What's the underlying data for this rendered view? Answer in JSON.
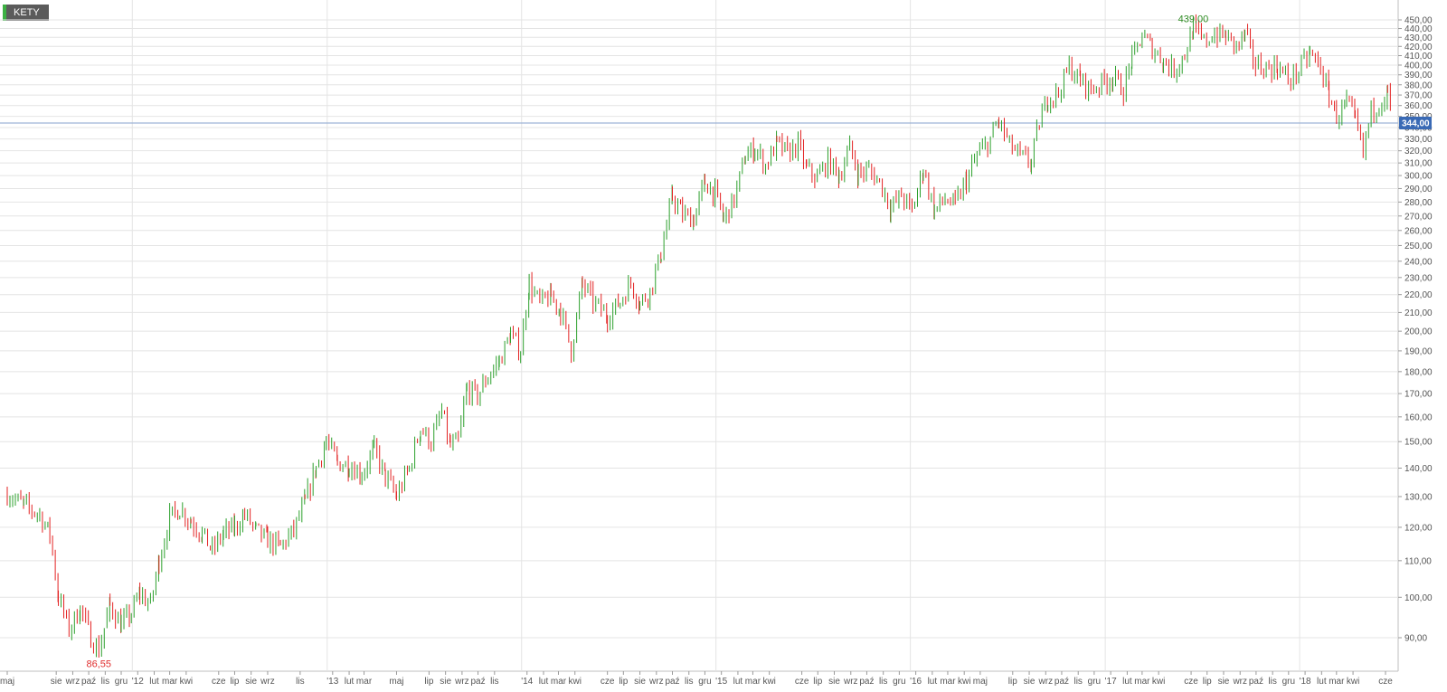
{
  "symbol": "KETY",
  "colors": {
    "up": "#2ca02c",
    "down": "#e32222",
    "grid": "#e4e4e4",
    "priceline": "#9db3d6",
    "pricetag": "#3a6ab5"
  },
  "chart_data": {
    "type": "candlestick",
    "title": "KETY",
    "y_scale": "log",
    "ylim": [
      84,
      460
    ],
    "y_ticks": [
      "90,00",
      "100,00",
      "110,00",
      "120,00",
      "130,00",
      "140,00",
      "150,00",
      "160,00",
      "170,00",
      "180,00",
      "190,00",
      "200,00",
      "210,00",
      "220,00",
      "230,00",
      "240,00",
      "250,00",
      "260,00",
      "270,00",
      "280,00",
      "290,00",
      "300,00",
      "310,00",
      "320,00",
      "330,00",
      "340,00",
      "350,00",
      "360,00",
      "370,00",
      "380,00",
      "390,00",
      "400,00",
      "410,00",
      "420,00",
      "430,00",
      "440,00",
      "450,00"
    ],
    "x_range": [
      "2011-05",
      "2018-06"
    ],
    "x_labels": [
      {
        "label": "maj",
        "date": "2011-05-01"
      },
      {
        "label": "sie",
        "date": "2011-08-01"
      },
      {
        "label": "wrz",
        "date": "2011-09-01"
      },
      {
        "label": "paź",
        "date": "2011-10-01"
      },
      {
        "label": "lis",
        "date": "2011-11-01"
      },
      {
        "label": "gru",
        "date": "2011-12-01"
      },
      {
        "label": "'12",
        "date": "2012-01-01"
      },
      {
        "label": "lut",
        "date": "2012-02-01"
      },
      {
        "label": "mar",
        "date": "2012-03-01"
      },
      {
        "label": "kwi",
        "date": "2012-04-01"
      },
      {
        "label": "cze",
        "date": "2012-06-01"
      },
      {
        "label": "lip",
        "date": "2012-07-01"
      },
      {
        "label": "sie",
        "date": "2012-08-01"
      },
      {
        "label": "wrz",
        "date": "2012-09-01"
      },
      {
        "label": "lis",
        "date": "2012-11-01"
      },
      {
        "label": "'13",
        "date": "2013-01-01"
      },
      {
        "label": "lut",
        "date": "2013-02-01"
      },
      {
        "label": "mar",
        "date": "2013-03-01"
      },
      {
        "label": "maj",
        "date": "2013-05-01"
      },
      {
        "label": "lip",
        "date": "2013-07-01"
      },
      {
        "label": "sie",
        "date": "2013-08-01"
      },
      {
        "label": "wrz",
        "date": "2013-09-01"
      },
      {
        "label": "paź",
        "date": "2013-10-01"
      },
      {
        "label": "lis",
        "date": "2013-11-01"
      },
      {
        "label": "'14",
        "date": "2014-01-01"
      },
      {
        "label": "lut",
        "date": "2014-02-01"
      },
      {
        "label": "mar",
        "date": "2014-03-01"
      },
      {
        "label": "kwi",
        "date": "2014-04-01"
      },
      {
        "label": "cze",
        "date": "2014-06-01"
      },
      {
        "label": "lip",
        "date": "2014-07-01"
      },
      {
        "label": "sie",
        "date": "2014-08-01"
      },
      {
        "label": "wrz",
        "date": "2014-09-01"
      },
      {
        "label": "paź",
        "date": "2014-10-01"
      },
      {
        "label": "lis",
        "date": "2014-11-01"
      },
      {
        "label": "gru",
        "date": "2014-12-01"
      },
      {
        "label": "'15",
        "date": "2015-01-01"
      },
      {
        "label": "lut",
        "date": "2015-02-01"
      },
      {
        "label": "mar",
        "date": "2015-03-01"
      },
      {
        "label": "kwi",
        "date": "2015-04-01"
      },
      {
        "label": "cze",
        "date": "2015-06-01"
      },
      {
        "label": "lip",
        "date": "2015-07-01"
      },
      {
        "label": "sie",
        "date": "2015-08-01"
      },
      {
        "label": "wrz",
        "date": "2015-09-01"
      },
      {
        "label": "paź",
        "date": "2015-10-01"
      },
      {
        "label": "lis",
        "date": "2015-11-01"
      },
      {
        "label": "gru",
        "date": "2015-12-01"
      },
      {
        "label": "'16",
        "date": "2016-01-01"
      },
      {
        "label": "lut",
        "date": "2016-02-01"
      },
      {
        "label": "mar",
        "date": "2016-03-01"
      },
      {
        "label": "kwi",
        "date": "2016-04-01"
      },
      {
        "label": "maj",
        "date": "2016-05-01"
      },
      {
        "label": "lip",
        "date": "2016-07-01"
      },
      {
        "label": "sie",
        "date": "2016-08-01"
      },
      {
        "label": "wrz",
        "date": "2016-09-01"
      },
      {
        "label": "paź",
        "date": "2016-10-01"
      },
      {
        "label": "lis",
        "date": "2016-11-01"
      },
      {
        "label": "gru",
        "date": "2016-12-01"
      },
      {
        "label": "'17",
        "date": "2017-01-01"
      },
      {
        "label": "lut",
        "date": "2017-02-01"
      },
      {
        "label": "mar",
        "date": "2017-03-01"
      },
      {
        "label": "kwi",
        "date": "2017-04-01"
      },
      {
        "label": "cze",
        "date": "2017-06-01"
      },
      {
        "label": "lip",
        "date": "2017-07-01"
      },
      {
        "label": "sie",
        "date": "2017-08-01"
      },
      {
        "label": "wrz",
        "date": "2017-09-01"
      },
      {
        "label": "paź",
        "date": "2017-10-01"
      },
      {
        "label": "lis",
        "date": "2017-11-01"
      },
      {
        "label": "gru",
        "date": "2017-12-01"
      },
      {
        "label": "'18",
        "date": "2018-01-01"
      },
      {
        "label": "lut",
        "date": "2018-02-01"
      },
      {
        "label": "mar",
        "date": "2018-03-01"
      },
      {
        "label": "kwi",
        "date": "2018-04-01"
      },
      {
        "label": "cze",
        "date": "2018-06-01"
      }
    ],
    "series": [
      {
        "name": "KETY",
        "points": [
          [
            "2011-05-01",
            131
          ],
          [
            "2011-06-01",
            127
          ],
          [
            "2011-07-01",
            124
          ],
          [
            "2011-07-20",
            118
          ],
          [
            "2011-08-05",
            100
          ],
          [
            "2011-08-25",
            92
          ],
          [
            "2011-09-15",
            97
          ],
          [
            "2011-10-05",
            90
          ],
          [
            "2011-10-20",
            87
          ],
          [
            "2011-11-10",
            98
          ],
          [
            "2011-12-01",
            93
          ],
          [
            "2011-12-20",
            96
          ],
          [
            "2012-01-05",
            101
          ],
          [
            "2012-01-25",
            98
          ],
          [
            "2012-02-10",
            110
          ],
          [
            "2012-03-01",
            123
          ],
          [
            "2012-03-20",
            126
          ],
          [
            "2012-04-10",
            122
          ],
          [
            "2012-05-01",
            118
          ],
          [
            "2012-05-20",
            113
          ],
          [
            "2012-06-10",
            118
          ],
          [
            "2012-07-01",
            120
          ],
          [
            "2012-07-20",
            124
          ],
          [
            "2012-08-10",
            119
          ],
          [
            "2012-09-01",
            116
          ],
          [
            "2012-09-25",
            114
          ],
          [
            "2012-10-20",
            119
          ],
          [
            "2012-11-10",
            128
          ],
          [
            "2012-12-01",
            140
          ],
          [
            "2012-12-20",
            150
          ],
          [
            "2013-01-10",
            142
          ],
          [
            "2013-02-01",
            141
          ],
          [
            "2013-02-25",
            138
          ],
          [
            "2013-03-20",
            147
          ],
          [
            "2013-04-10",
            137
          ],
          [
            "2013-05-01",
            130
          ],
          [
            "2013-05-25",
            140
          ],
          [
            "2013-06-15",
            155
          ],
          [
            "2013-07-05",
            150
          ],
          [
            "2013-07-25",
            162
          ],
          [
            "2013-08-10",
            148
          ],
          [
            "2013-08-25",
            150
          ],
          [
            "2013-09-10",
            172
          ],
          [
            "2013-09-30",
            169
          ],
          [
            "2013-10-20",
            178
          ],
          [
            "2013-11-10",
            185
          ],
          [
            "2013-12-01",
            198
          ],
          [
            "2013-12-20",
            190
          ],
          [
            "2014-01-05",
            226
          ],
          [
            "2014-01-25",
            215
          ],
          [
            "2014-02-15",
            219
          ],
          [
            "2014-03-05",
            211
          ],
          [
            "2014-03-25",
            190
          ],
          [
            "2014-04-15",
            226
          ],
          [
            "2014-05-05",
            216
          ],
          [
            "2014-06-01",
            208
          ],
          [
            "2014-06-25",
            216
          ],
          [
            "2014-07-15",
            227
          ],
          [
            "2014-08-01",
            215
          ],
          [
            "2014-08-20",
            222
          ],
          [
            "2014-09-10",
            245
          ],
          [
            "2014-10-01",
            284
          ],
          [
            "2014-10-20",
            271
          ],
          [
            "2014-11-10",
            268
          ],
          [
            "2014-12-01",
            295
          ],
          [
            "2014-12-20",
            286
          ],
          [
            "2015-01-05",
            268
          ],
          [
            "2015-01-25",
            282
          ],
          [
            "2015-02-15",
            315
          ],
          [
            "2015-03-05",
            322
          ],
          [
            "2015-03-25",
            308
          ],
          [
            "2015-04-15",
            326
          ],
          [
            "2015-05-05",
            318
          ],
          [
            "2015-05-25",
            325
          ],
          [
            "2015-06-10",
            305
          ],
          [
            "2015-06-30",
            298
          ],
          [
            "2015-07-20",
            312
          ],
          [
            "2015-08-10",
            300
          ],
          [
            "2015-08-30",
            322
          ],
          [
            "2015-09-15",
            302
          ],
          [
            "2015-10-05",
            304
          ],
          [
            "2015-10-25",
            295
          ],
          [
            "2015-11-15",
            276
          ],
          [
            "2015-12-05",
            285
          ],
          [
            "2015-12-25",
            273
          ],
          [
            "2016-01-15",
            305
          ],
          [
            "2016-02-05",
            274
          ],
          [
            "2016-02-25",
            282
          ],
          [
            "2016-03-15",
            278
          ],
          [
            "2016-04-05",
            296
          ],
          [
            "2016-04-25",
            316
          ],
          [
            "2016-05-15",
            326
          ],
          [
            "2016-06-05",
            345
          ],
          [
            "2016-06-25",
            325
          ],
          [
            "2016-07-15",
            315
          ],
          [
            "2016-08-05",
            310
          ],
          [
            "2016-08-20",
            345
          ],
          [
            "2016-09-05",
            367
          ],
          [
            "2016-09-25",
            372
          ],
          [
            "2016-10-15",
            398
          ],
          [
            "2016-11-05",
            385
          ],
          [
            "2016-11-25",
            375
          ],
          [
            "2016-12-15",
            382
          ],
          [
            "2017-01-05",
            387
          ],
          [
            "2017-01-25",
            375
          ],
          [
            "2017-02-10",
            405
          ],
          [
            "2017-03-01",
            432
          ],
          [
            "2017-03-20",
            418
          ],
          [
            "2017-04-10",
            404
          ],
          [
            "2017-04-30",
            395
          ],
          [
            "2017-05-20",
            412
          ],
          [
            "2017-06-05",
            439
          ],
          [
            "2017-06-25",
            425
          ],
          [
            "2017-07-15",
            434
          ],
          [
            "2017-08-05",
            431
          ],
          [
            "2017-08-25",
            420
          ],
          [
            "2017-09-10",
            432
          ],
          [
            "2017-09-30",
            400
          ],
          [
            "2017-10-20",
            397
          ],
          [
            "2017-11-10",
            398
          ],
          [
            "2017-11-30",
            385
          ],
          [
            "2017-12-20",
            394
          ],
          [
            "2018-01-10",
            412
          ],
          [
            "2018-01-30",
            398
          ],
          [
            "2018-02-15",
            370
          ],
          [
            "2018-03-01",
            350
          ],
          [
            "2018-03-20",
            362
          ],
          [
            "2018-04-05",
            346
          ],
          [
            "2018-04-20",
            318
          ],
          [
            "2018-05-05",
            355
          ],
          [
            "2018-05-20",
            363
          ],
          [
            "2018-06-05",
            372
          ],
          [
            "2018-06-15",
            344
          ]
        ]
      }
    ],
    "annotations": [
      {
        "text": "439,00",
        "date": "2017-06-05",
        "value": 439
      },
      {
        "text": "86,55",
        "date": "2011-10-20",
        "value": 86.55
      }
    ],
    "last_price": {
      "text": "344,00",
      "value": 344
    },
    "grid": true
  }
}
